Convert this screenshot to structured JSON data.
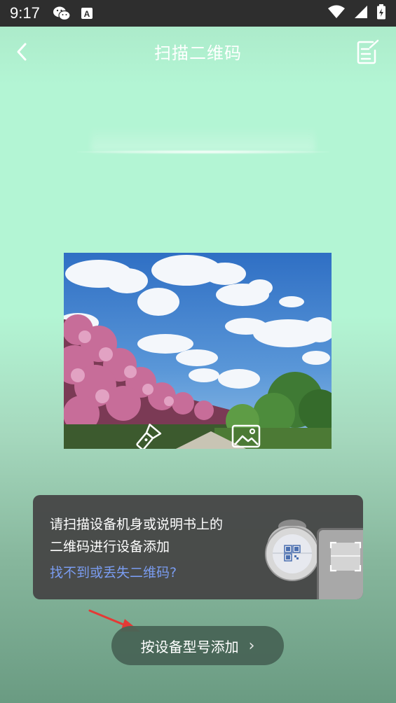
{
  "status_bar": {
    "time": "9:17",
    "icons": [
      "wechat-icon",
      "a-letter-icon",
      "wifi-icon",
      "signal-icon",
      "battery-icon"
    ]
  },
  "header": {
    "title": "扫描二维码",
    "back_icon": "chevron-left-icon",
    "history_icon": "note-edit-icon"
  },
  "preview": {
    "flashlight_icon": "flashlight-icon",
    "album_icon": "image-icon"
  },
  "hint": {
    "text": "请扫描设备机身或说明书上的二维码进行设备添加",
    "link": "找不到或丢失二维码?"
  },
  "add_by_model": {
    "label": "按设备型号添加",
    "chevron": "›"
  },
  "colors": {
    "accent_link": "#7a9cf0",
    "annotation_arrow": "#e53935"
  }
}
